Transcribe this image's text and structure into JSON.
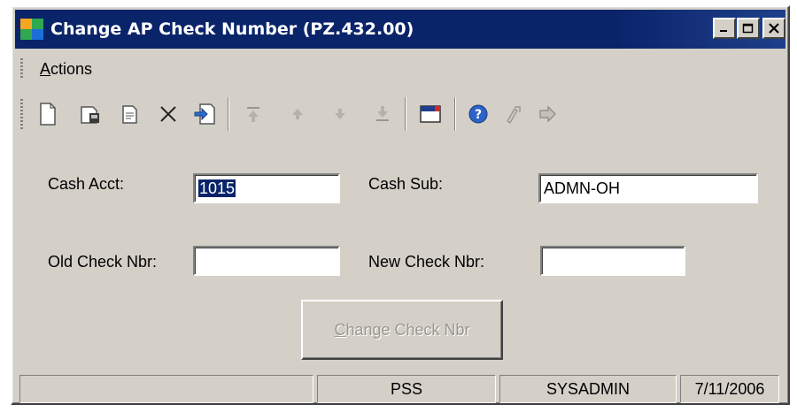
{
  "window": {
    "title": "Change AP Check Number (PZ.432.00)",
    "controls": {
      "minimize_icon": "minimize-icon",
      "maximize_icon": "maximize-icon",
      "close_icon": "close-icon"
    }
  },
  "menu": {
    "items": [
      {
        "label_u": "A",
        "label_rest": "ctions"
      }
    ]
  },
  "toolbar": {
    "icons": [
      "new-document-icon",
      "save-icon",
      "copy-icon",
      "delete-icon",
      "paste-icon",
      "first-record-icon",
      "previous-record-icon",
      "next-record-icon",
      "last-record-icon",
      "notes-icon",
      "help-icon",
      "customize-icon",
      "close-screen-icon"
    ]
  },
  "form": {
    "cash_acct": {
      "label": "Cash Acct:",
      "value": "1015"
    },
    "cash_sub": {
      "label": "Cash Sub:",
      "value": "ADMN-OH"
    },
    "old_check": {
      "label": "Old Check Nbr:",
      "value": ""
    },
    "new_check": {
      "label": "New Check Nbr:",
      "value": ""
    },
    "change_button": {
      "label_u": "C",
      "label_rest": "hange Check Nbr"
    }
  },
  "statusbar": {
    "panels": [
      "",
      "PSS",
      "SYSADMIN",
      "7/11/2006"
    ]
  },
  "colors": {
    "titlebar": "#0a246a",
    "face": "#d4d0c8",
    "selection": "#0a246a",
    "disabled_text": "#9a978f"
  }
}
